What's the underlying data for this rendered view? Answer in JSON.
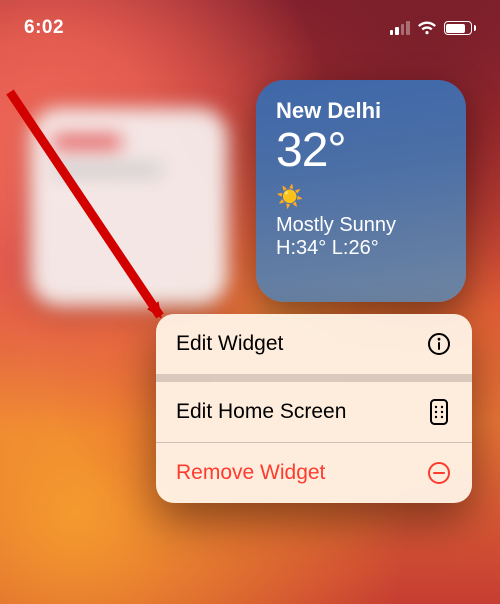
{
  "status": {
    "time": "6:02",
    "signal_bars_active": 2,
    "battery_fill_pct": 78
  },
  "weather": {
    "city": "New Delhi",
    "temp": "32°",
    "sun_glyph": "☀️",
    "condition": "Mostly Sunny",
    "high_low": "H:34° L:26°"
  },
  "menu": {
    "edit_widget": "Edit Widget",
    "edit_home_screen": "Edit Home Screen",
    "remove_widget": "Remove Widget"
  },
  "colors": {
    "destructive": "#ff3b30"
  }
}
